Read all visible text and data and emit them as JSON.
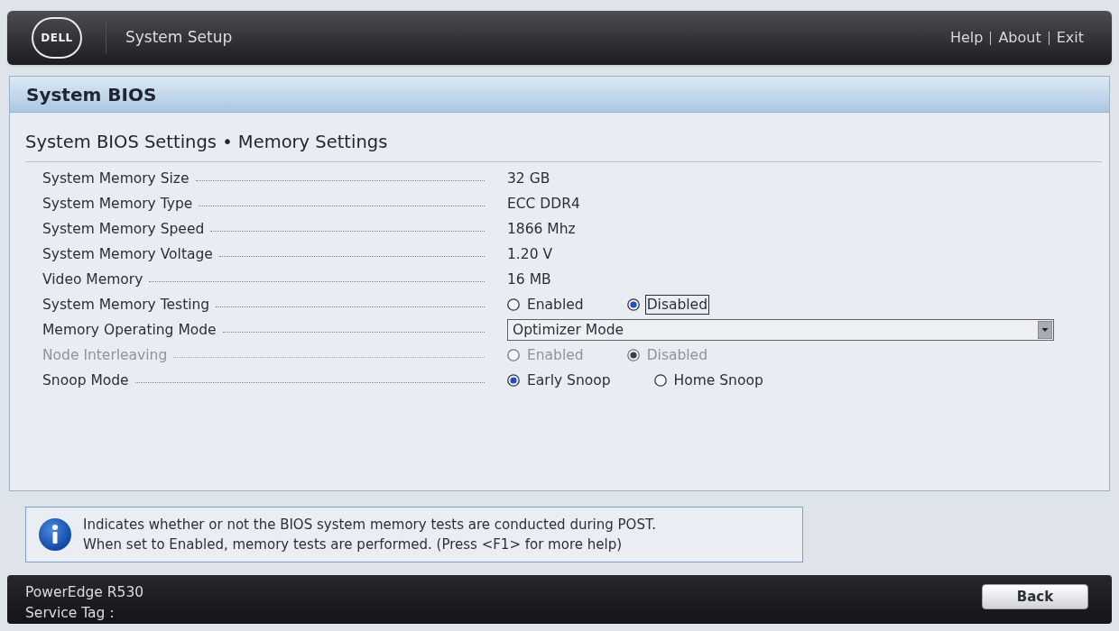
{
  "header": {
    "logo": "DELL",
    "title": "System Setup",
    "links": [
      "Help",
      "About",
      "Exit"
    ]
  },
  "panel": {
    "title": "System BIOS",
    "subtitle": "System BIOS Settings • Memory Settings"
  },
  "settings": [
    {
      "label": "System Memory Size",
      "kind": "text",
      "disabled": false,
      "value": "32 GB"
    },
    {
      "label": "System Memory Type",
      "kind": "text",
      "disabled": false,
      "value": "ECC DDR4"
    },
    {
      "label": "System Memory Speed",
      "kind": "text",
      "disabled": false,
      "value": "1866 Mhz"
    },
    {
      "label": "System Memory Voltage",
      "kind": "text",
      "disabled": false,
      "value": "1.20 V"
    },
    {
      "label": "Video Memory",
      "kind": "text",
      "disabled": false,
      "value": "16 MB"
    },
    {
      "label": "System Memory Testing",
      "kind": "radio",
      "disabled": false,
      "options": [
        {
          "label": "Enabled",
          "selected": false,
          "focused": false
        },
        {
          "label": "Disabled",
          "selected": true,
          "focused": true
        }
      ]
    },
    {
      "label": "Memory Operating Mode",
      "kind": "dropdown",
      "disabled": false,
      "value": "Optimizer Mode"
    },
    {
      "label": "Node Interleaving",
      "kind": "radio",
      "disabled": true,
      "options": [
        {
          "label": "Enabled",
          "selected": false,
          "focused": false
        },
        {
          "label": "Disabled",
          "selected": true,
          "focused": false
        }
      ]
    },
    {
      "label": "Snoop Mode",
      "kind": "radio",
      "disabled": false,
      "options": [
        {
          "label": "Early Snoop",
          "selected": true,
          "focused": false
        },
        {
          "label": "Home Snoop",
          "selected": false,
          "focused": false
        }
      ]
    }
  ],
  "help": {
    "lines": [
      "Indicates whether or not the BIOS system memory tests are conducted during POST.",
      "When set to Enabled, memory tests are performed. (Press <F1> for more help)"
    ]
  },
  "footer": {
    "model": "PowerEdge R530",
    "service_tag_label": "Service Tag :",
    "button": "Back"
  }
}
